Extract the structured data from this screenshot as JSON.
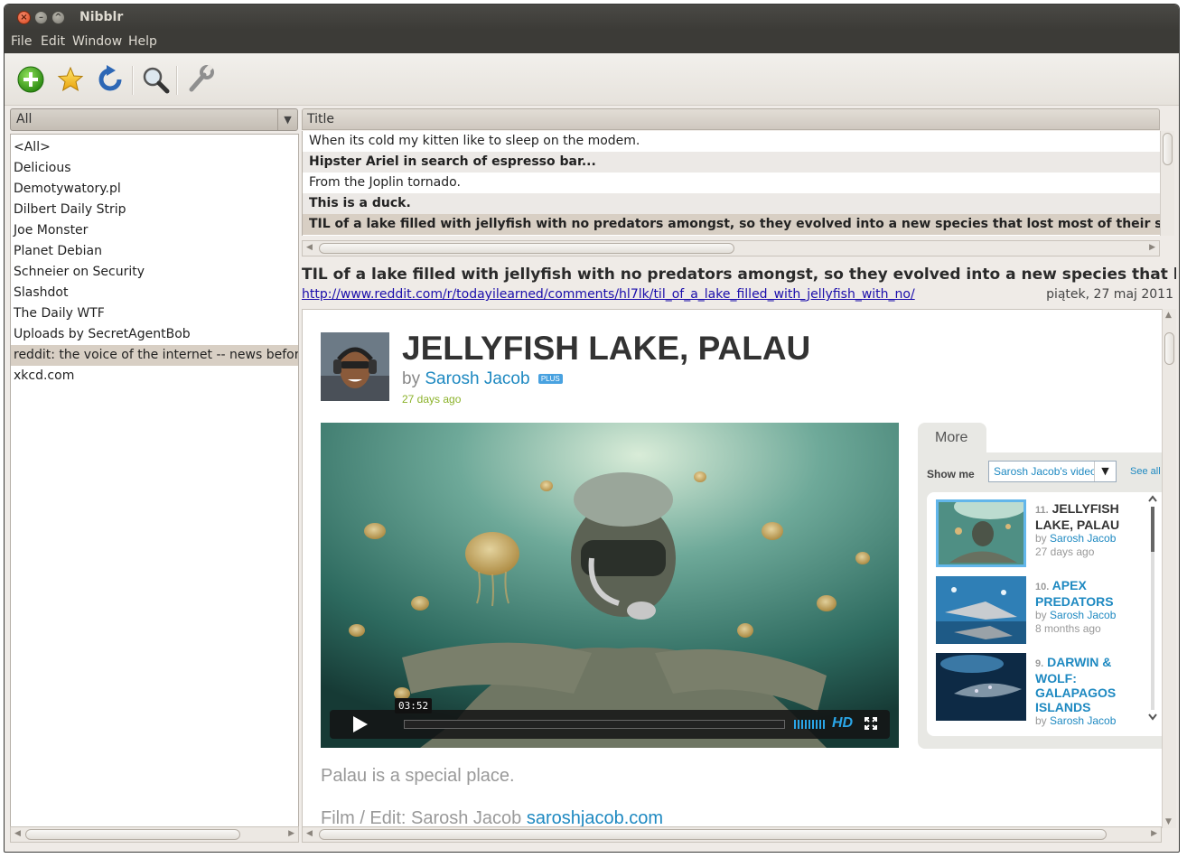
{
  "window": {
    "title": "Nibblr"
  },
  "menu": [
    "File",
    "Edit",
    "Window",
    "Help"
  ],
  "toolbar": {
    "icons": [
      "add-feed-icon",
      "star-icon",
      "refresh-icon",
      "search-icon",
      "preferences-wrench-icon"
    ]
  },
  "feeds": {
    "filter": "All",
    "items": [
      "<All>",
      "Delicious",
      "Demotywatory.pl",
      "Dilbert Daily Strip",
      "Joe Monster",
      "Planet Debian",
      "Schneier on Security",
      "Slashdot",
      "The Daily WTF",
      "Uploads by SecretAgentBob",
      "reddit: the voice of the internet -- news before it",
      "xkcd.com"
    ],
    "selected_index": 10
  },
  "articles": {
    "column_header": "Title",
    "rows": [
      {
        "title": "When its cold my kitten like to sleep on the modem.",
        "bold": false
      },
      {
        "title": "Hipster Ariel in search of espresso bar...",
        "bold": true
      },
      {
        "title": "From the Joplin tornado.",
        "bold": false
      },
      {
        "title": "This is a duck.",
        "bold": true
      },
      {
        "title": "TIL of a lake filled with jellyfish with no predators amongst, so they evolved into a new species that lost most of their stingi",
        "bold": true
      }
    ],
    "selected_index": 4
  },
  "article": {
    "title": "TIL of a lake filled with jellyfish with no predators amongst, so they evolved into a new species that lost m",
    "url": "http://www.reddit.com/r/todayilearned/comments/hl7lk/til_of_a_lake_filled_with_jellyfish_with_no/",
    "date": "piątek, 27 maj 2011"
  },
  "video_page": {
    "title": "JELLYFISH LAKE, PALAU",
    "by_prefix": "by",
    "author": "Sarosh Jacob",
    "badge": "PLUS",
    "posted": "27 days ago",
    "timecode": "03:52",
    "hd_label": "HD",
    "description": "Palau is a special place.",
    "credit_prefix": "Film / Edit: Sarosh Jacob",
    "credit_link": "saroshjacob.com",
    "more": {
      "tab": "More",
      "show_me_label": "Show me",
      "show_me_value": "Sarosh Jacob's videos",
      "see_all": "See all",
      "videos": [
        {
          "num": "11.",
          "title": "JELLYFISH LAKE, PALAU",
          "by": "by",
          "author": "Sarosh Jacob",
          "age": "27 days ago",
          "active": true
        },
        {
          "num": "10.",
          "title": "APEX PREDATORS",
          "by": "by",
          "author": "Sarosh Jacob",
          "age": "8 months ago",
          "active": false
        },
        {
          "num": "9.",
          "title": "DARWIN & WOLF: GALAPAGOS ISLANDS",
          "by": "by",
          "author": "Sarosh Jacob",
          "age": "",
          "active": false
        }
      ]
    }
  },
  "colors": {
    "accent_link": "#1e89c1",
    "selection": "#d8cfc4",
    "titlebar": "#3c3b37"
  }
}
